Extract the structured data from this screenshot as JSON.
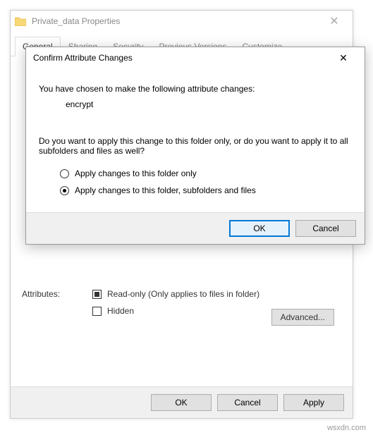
{
  "properties": {
    "title": "Private_data Properties",
    "tabs": {
      "general": "General",
      "sharing": "Sharing",
      "security": "Security",
      "previous": "Previous Versions",
      "customize": "Customize"
    },
    "attributes_label": "Attributes:",
    "readonly_label": "Read-only (Only applies to files in folder)",
    "hidden_label": "Hidden",
    "advanced_label": "Advanced...",
    "ok_label": "OK",
    "cancel_label": "Cancel",
    "apply_label": "Apply"
  },
  "confirm": {
    "title": "Confirm Attribute Changes",
    "intro": "You have chosen to make the following attribute changes:",
    "change_item": "encrypt",
    "question": "Do you want to apply this change to this folder only, or do you want to apply it to all subfolders and files as well?",
    "option_folder_only": "Apply changes to this folder only",
    "option_recursive": "Apply changes to this folder, subfolders and files",
    "ok_label": "OK",
    "cancel_label": "Cancel"
  },
  "watermark": "wsxdn.com"
}
